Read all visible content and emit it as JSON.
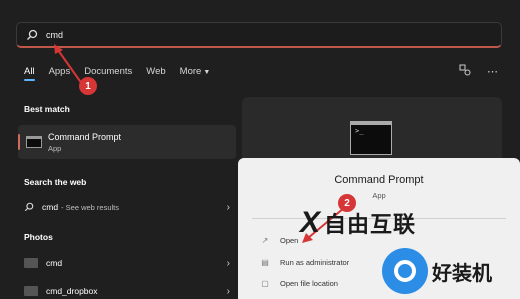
{
  "search": {
    "value": "cmd"
  },
  "tabs": [
    {
      "label": "All",
      "active": true
    },
    {
      "label": "Apps"
    },
    {
      "label": "Documents"
    },
    {
      "label": "Web"
    },
    {
      "label": "More"
    }
  ],
  "sections": {
    "best_match": "Best match",
    "search_web": "Search the web",
    "photos": "Photos"
  },
  "best_match": {
    "title": "Command Prompt",
    "subtitle": "App"
  },
  "web_result": {
    "query": "cmd",
    "suffix": "- See web results"
  },
  "photos": [
    {
      "name": "cmd"
    },
    {
      "name": "cmd_dropbox"
    }
  ],
  "preview": {
    "title": "Command Prompt",
    "subtitle": "App",
    "actions": [
      {
        "label": "Open",
        "icon": "open-external-icon"
      },
      {
        "label": "Run as administrator",
        "icon": "shield-icon"
      },
      {
        "label": "Open file location",
        "icon": "folder-icon"
      }
    ]
  },
  "annotations": {
    "step1": "1",
    "step2": "2"
  },
  "watermarks": {
    "middle": "自由互联",
    "bottom_right": "好装机"
  },
  "colors": {
    "accent_blue": "#5fb2ff",
    "accent_red": "#d63636",
    "search_underline": "#c0584a"
  }
}
